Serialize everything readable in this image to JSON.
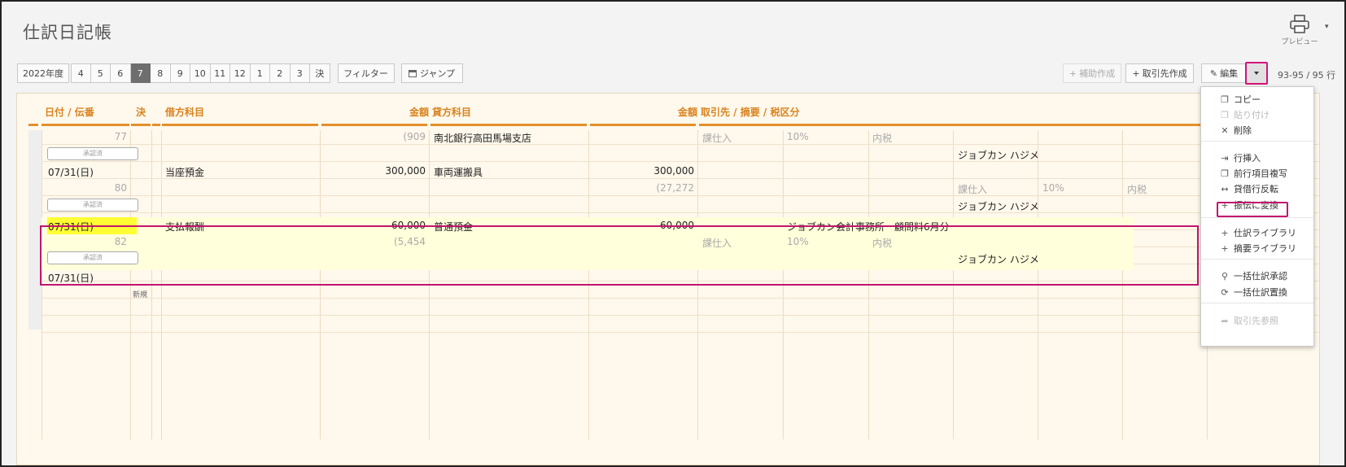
{
  "title": "仕訳日記帳",
  "preview": {
    "label": "プレビュー"
  },
  "toolbar": {
    "year": "2022年度",
    "months": [
      "4",
      "5",
      "6",
      "7",
      "8",
      "9",
      "10",
      "11",
      "12",
      "1",
      "2",
      "3",
      "決"
    ],
    "active_month": "7",
    "filter": "フィルター",
    "jump": "ジャンプ",
    "hojo": "補助作成",
    "torihikisaki": "取引先作成",
    "edit": "編集",
    "counter": "93-95 / 95 行"
  },
  "headers": {
    "date": "日付 / 伝番",
    "kessan": "決",
    "debit": "借方科目",
    "debit_amount": "金額",
    "credit": "貸方科目",
    "credit_amount": "金額",
    "memo": "取引先 / 摘要 / 税区分"
  },
  "rows": {
    "r1": {
      "no": "77",
      "debit_tax": "(909",
      "credit": "南北銀行高田馬場支店",
      "tax_type": "課仕入",
      "rate": "10%",
      "incl": "内税",
      "approve": "承認済",
      "user": "ジョブカン ハジメ"
    },
    "r2": {
      "date": "07/31(日)",
      "no": "80",
      "debit": "当座預金",
      "debit_amount": "300,000",
      "credit": "車両運搬具",
      "credit_amount": "300,000",
      "credit_tax": "(27,272",
      "tax_type": "課仕入",
      "rate": "10%",
      "incl": "内税",
      "approve": "承認済",
      "user": "ジョブカン ハジメ"
    },
    "r3": {
      "date": "07/31(日)",
      "no": "82",
      "debit": "支払報酬",
      "debit_amount": "60,000",
      "debit_tax": "(5,454",
      "credit": "普通預金",
      "credit_amount": "60,000",
      "memo": "ジョブカン会計事務所　顧問料6月分",
      "tax_type": "課仕入",
      "rate": "10%",
      "incl": "内税",
      "approve": "承認済",
      "user": "ジョブカン ハジメ"
    },
    "r4": {
      "date": "07/31(日)",
      "new": "新規"
    }
  },
  "menu": {
    "copy": "コピー",
    "paste": "貼り付け",
    "delete": "削除",
    "insert_row": "行挿入",
    "copy_prev": "前行項目複写",
    "swap": "貸借行反転",
    "convert": "振伝に変換",
    "library": "仕訳ライブラリ",
    "summary_library": "摘要ライブラリ",
    "bulk_approve": "一括仕訳承認",
    "bulk_replace": "一括仕訳置換",
    "partner_ref": "取引先参照"
  }
}
